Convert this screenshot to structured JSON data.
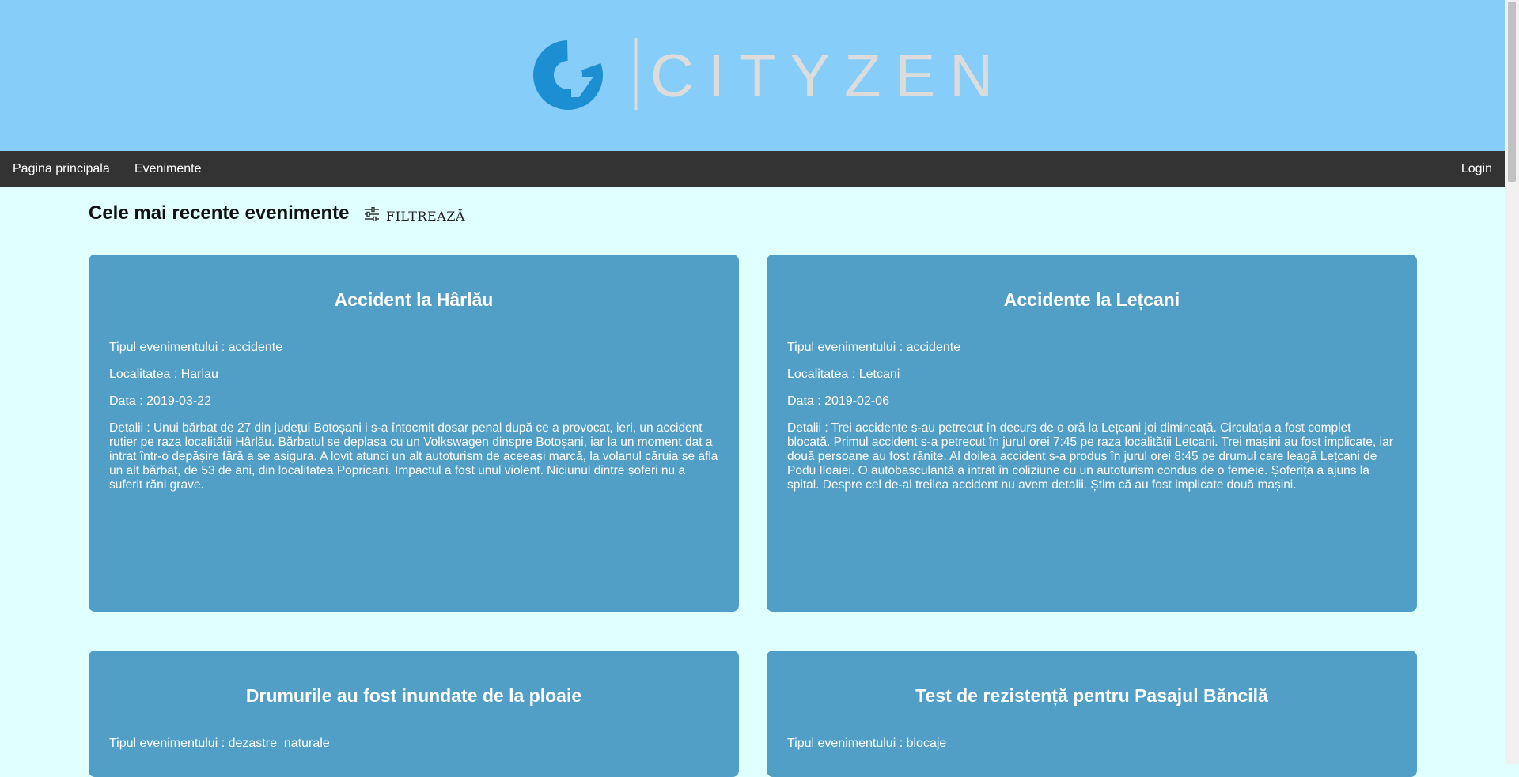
{
  "app": {
    "logo_text": "CITYZEN",
    "brand_blue": "#1b8fd2",
    "header_color": "#87cdf9"
  },
  "nav": {
    "home": "Pagina principala",
    "events": "Evenimente",
    "login": "Login"
  },
  "section": {
    "title": "Cele mai recente evenimente",
    "filter_label": "FILTREAZĂ",
    "filter_icon": "sliders-icon"
  },
  "events": [
    {
      "title": "Accident la Hârlău",
      "type": "Tipul evenimentului : accidente",
      "location": "Localitatea : Harlau",
      "date": "Data : 2019-03-22",
      "details": "Detalii : Unui bărbat de 27 din județul Botoșani i s-a întocmit dosar penal după ce a provocat, ieri, un accident rutier pe raza localității Hârlău. Bărbatul se deplasa cu un Volkswagen dinspre Botoșani, iar la un moment dat a intrat într-o depășire fără a se asigura. A lovit atunci un alt autoturism de aceeași marcă, la volanul căruia se afla un alt bărbat, de 53 de ani, din localitatea Popricani. Impactul a fost unul violent. Niciunul dintre șoferi nu a suferit răni grave."
    },
    {
      "title": "Accidente la Lețcani",
      "type": "Tipul evenimentului : accidente",
      "location": "Localitatea : Letcani",
      "date": "Data : 2019-02-06",
      "details": "Detalii : Trei accidente s-au petrecut în decurs de o oră la Lețcani joi dimineață. Circulația a fost complet blocată. Primul accident s-a petrecut în jurul orei 7:45 pe raza localității Lețcani. Trei mașini au fost implicate, iar două persoane au fost rănite. Al doilea accident s-a produs în jurul orei 8:45 pe drumul care leagă Lețcani de Podu Iloaiei. O autobasculantă a intrat în coliziune cu un autoturism condus de o femeie. Șoferița a ajuns la spital. Despre cel de-al treilea accident nu avem detalii. Știm că au fost implicate două mașini."
    },
    {
      "title": "Drumurile au fost inundate de la ploaie",
      "type": "Tipul evenimentului : dezastre_naturale"
    },
    {
      "title": "Test de rezistență pentru Pasajul Băncilă",
      "type": "Tipul evenimentului : blocaje"
    }
  ]
}
